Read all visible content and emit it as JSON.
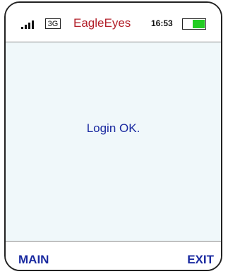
{
  "status_bar": {
    "signal_icon": "signal-bars-icon",
    "network": "3G",
    "app_title": "EagleEyes",
    "time": "16:53",
    "battery_icon": "battery-icon",
    "battery_level": 0.6
  },
  "main": {
    "message": "Login OK."
  },
  "softkeys": {
    "left_label": "MAIN",
    "right_label": "EXIT"
  },
  "colors": {
    "title": "#b3202a",
    "accent": "#1a2aa0",
    "battery": "#22cc22",
    "content_bg": "#f0f8fa"
  }
}
